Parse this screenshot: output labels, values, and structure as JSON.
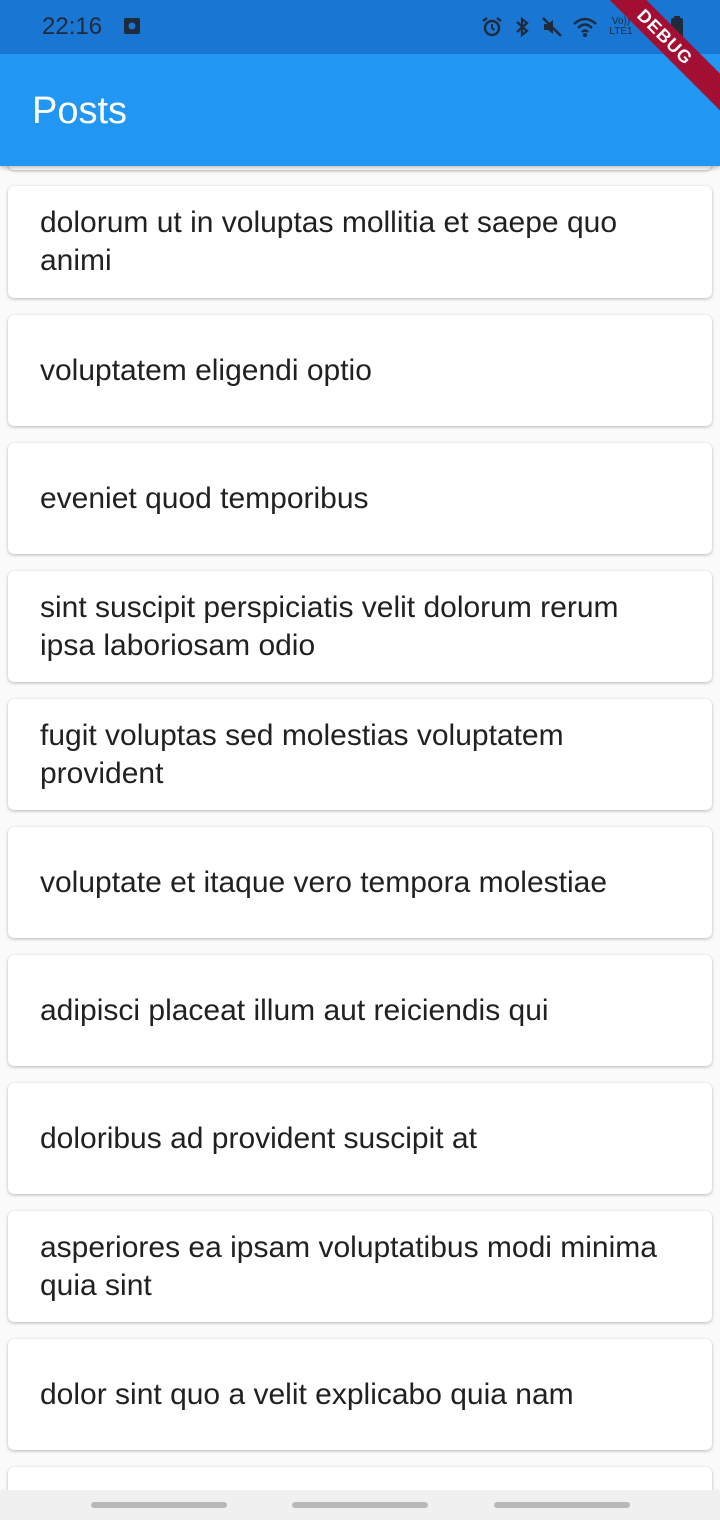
{
  "status_bar": {
    "time": "22:16",
    "left_icon": "screenshot-notification-icon",
    "network_label_top": "Vo))",
    "network_label_bottom": "LTE1",
    "icons": [
      "alarm-icon",
      "bluetooth-icon",
      "mute-icon",
      "wifi-icon",
      "signal-icon",
      "battery-icon"
    ]
  },
  "app_bar": {
    "title": "Posts",
    "color": "#2196f3"
  },
  "debug_banner": "DEBUG",
  "posts": [
    {
      "title": ""
    },
    {
      "title": "dolorum ut in voluptas mollitia et saepe quo animi"
    },
    {
      "title": "voluptatem eligendi optio"
    },
    {
      "title": "eveniet quod temporibus"
    },
    {
      "title": "sint suscipit perspiciatis velit dolorum rerum ipsa laboriosam odio"
    },
    {
      "title": "fugit voluptas sed molestias voluptatem provident"
    },
    {
      "title": "voluptate et itaque vero tempora molestiae"
    },
    {
      "title": "adipisci placeat illum aut reiciendis qui"
    },
    {
      "title": "doloribus ad provident suscipit at"
    },
    {
      "title": "asperiores ea ipsam voluptatibus modi minima quia sint"
    },
    {
      "title": "dolor sint quo a velit explicabo quia nam"
    },
    {
      "title": ""
    }
  ],
  "nav_bar": {
    "pills": [
      "recent-apps-pill",
      "home-pill",
      "back-pill"
    ]
  }
}
